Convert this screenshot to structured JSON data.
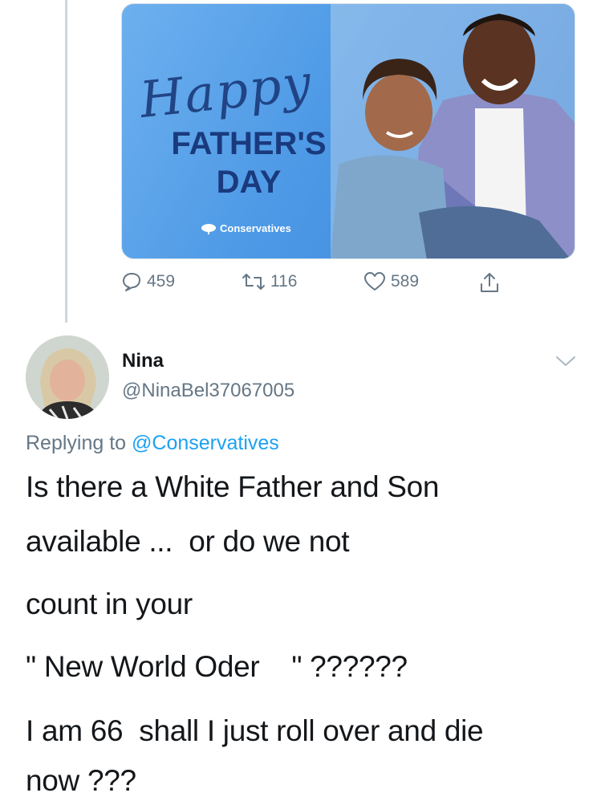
{
  "media": {
    "script_word": "Happy",
    "headline_line1": "FATHER'S",
    "headline_line2": "DAY",
    "brand": "Conservatives"
  },
  "actions": {
    "replies": "459",
    "retweets": "116",
    "likes": "589"
  },
  "reply": {
    "display_name": "Nina",
    "handle": "@NinaBel37067005",
    "replying_prefix": "Replying to",
    "replying_mention": "@Conservatives",
    "lines": [
      "Is there a White Father and Son",
      "available ...  or do we not",
      "count in your",
      "\" New World Oder    \" ??????",
      "I am 66  shall I just roll over and die",
      "now ???"
    ]
  },
  "colors": {
    "accent": "#1da1f2",
    "muted": "#657786",
    "text": "#14171a",
    "card_blue": "#4d99e6",
    "headline_navy": "#1a3a7e"
  }
}
